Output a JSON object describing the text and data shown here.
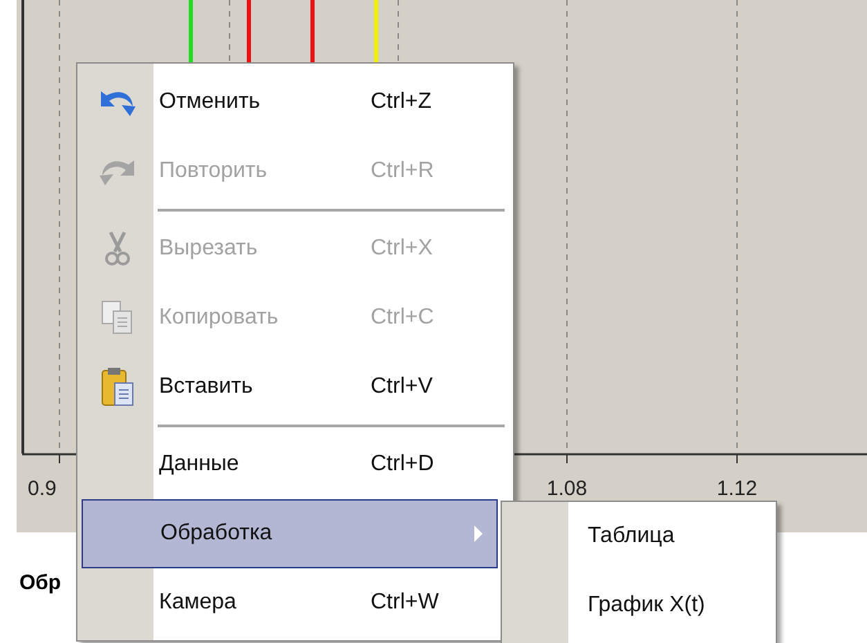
{
  "chart": {
    "markers": [
      {
        "color": "#22dd22"
      },
      {
        "color": "#ee1111"
      },
      {
        "color": "#ee1111"
      },
      {
        "color": "#f0f000"
      }
    ],
    "tick_labels": [
      "0.9",
      "1.08",
      "1.12"
    ]
  },
  "caption": "Обр",
  "context_menu": {
    "items": [
      {
        "kind": "item",
        "label": "Отменить",
        "shortcut": "Ctrl+Z",
        "disabled": false,
        "selected": false
      },
      {
        "kind": "item",
        "label": "Повторить",
        "shortcut": "Ctrl+R",
        "disabled": true,
        "selected": false
      },
      {
        "kind": "separator"
      },
      {
        "kind": "item",
        "label": "Вырезать",
        "shortcut": "Ctrl+X",
        "disabled": true,
        "selected": false
      },
      {
        "kind": "item",
        "label": "Копировать",
        "shortcut": "Ctrl+C",
        "disabled": true,
        "selected": false
      },
      {
        "kind": "item",
        "label": "Вставить",
        "shortcut": "Ctrl+V",
        "disabled": false,
        "selected": false
      },
      {
        "kind": "separator"
      },
      {
        "kind": "item",
        "label": "Данные",
        "shortcut": "Ctrl+D",
        "disabled": false,
        "selected": false
      },
      {
        "kind": "submenu",
        "label": "Обработка",
        "disabled": false,
        "selected": true
      },
      {
        "kind": "item",
        "label": "Камера",
        "shortcut": "Ctrl+W",
        "disabled": false,
        "selected": false
      }
    ]
  },
  "submenu": {
    "items": [
      {
        "label": "Таблица",
        "selected": false
      },
      {
        "label": "График X(t)",
        "selected": false
      }
    ]
  }
}
